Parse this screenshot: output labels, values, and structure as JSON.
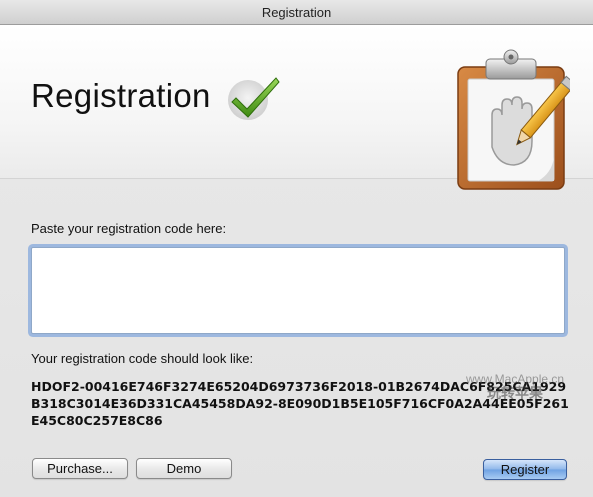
{
  "window": {
    "title": "Registration"
  },
  "header": {
    "title": "Registration",
    "check_icon": "checkmark-icon",
    "clipboard_icon": "clipboard-hand-pencil-icon"
  },
  "form": {
    "prompt": "Paste your registration code here:",
    "code_value": "",
    "example_label": "Your registration code should look like:",
    "example_code": "HDOF2-00416E746F3274E65204D6973736F2018-01B2674DAC6F825CA1929B318C3014E36D331CA45458DA92-8E090D1B5E105F716CF0A2A44EE05F261E45C80C257E8C86"
  },
  "watermark": {
    "line1": "www.MacApple.cn",
    "line2": "玩转苹果"
  },
  "buttons": {
    "purchase": "Purchase...",
    "demo": "Demo",
    "register": "Register"
  },
  "colors": {
    "accent": "#6ea1e2",
    "check": "#5aa321",
    "clipboard": "#b5652a"
  }
}
